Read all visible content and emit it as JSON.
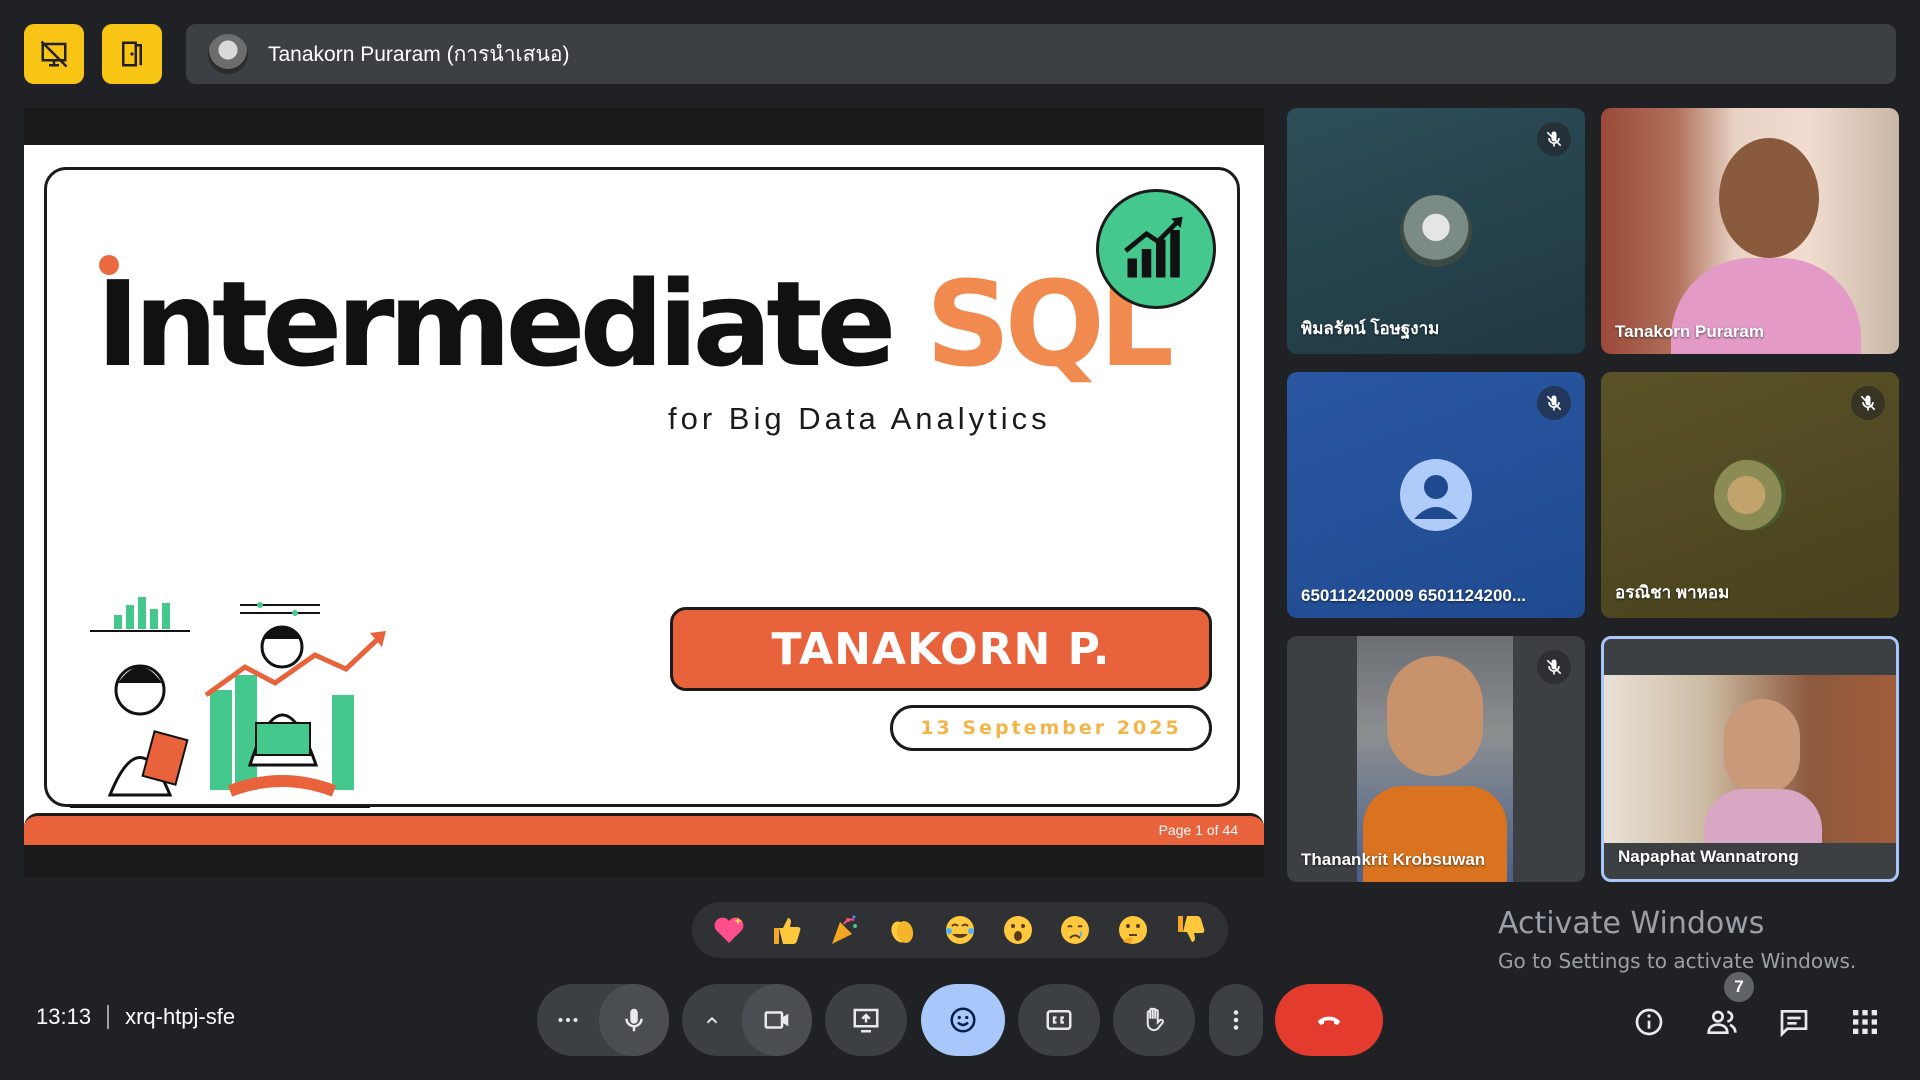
{
  "topbar": {
    "presenter_label": "Tanakorn Puraram (การนำเสนอ)",
    "icons": [
      "presentation-off-icon",
      "exit-door-icon"
    ]
  },
  "slide": {
    "title_main": "Intermediate ",
    "title_accent": "SQL",
    "subtitle": "for Big Data Analytics",
    "presenter_name": "TANAKORN P.",
    "date": "13 September 2025",
    "page_indicator": "Page 1 of 44",
    "colors": {
      "accent": "#e8623b",
      "title_accent": "#f08a4f",
      "logo_bg": "#45c88d",
      "date_text": "#f3b54a"
    }
  },
  "participants": [
    {
      "name": "พิมลรัตน์ โอษฐงาม",
      "muted": true,
      "bg": "#243f4a"
    },
    {
      "name": "Tanakorn Puraram",
      "muted": false,
      "bg": "#b07060"
    },
    {
      "name": "650112420009 6501124200...",
      "muted": true,
      "bg": "#1f4a8f"
    },
    {
      "name": "อรณิชา พาหอม",
      "muted": true,
      "bg": "#4f4a22"
    },
    {
      "name": "Thanankrit Krobsuwan",
      "muted": true,
      "bg": "#3c4043"
    },
    {
      "name": "Napaphat Wannatrong",
      "muted": false,
      "bg": "#a97e5c"
    }
  ],
  "activation": {
    "title": "Activate Windows",
    "subtitle": "Go to Settings to activate Windows."
  },
  "reactions": [
    "sparkling-heart",
    "thumbs-up",
    "party-popper",
    "clapping-hands",
    "tears-of-joy",
    "open-mouth",
    "crying-face",
    "thinking-face",
    "thumbs-down"
  ],
  "meeting": {
    "time": "13:13",
    "code": "xrq-htpj-sfe",
    "participant_count": "7"
  }
}
